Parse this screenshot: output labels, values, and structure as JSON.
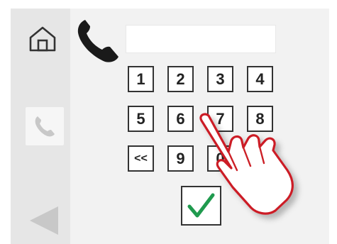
{
  "sidebar": {
    "home": {
      "icon": "home-icon"
    },
    "phone": {
      "icon": "phone-icon"
    },
    "back": {
      "icon": "back-arrow-icon"
    }
  },
  "header": {
    "call_icon": "phone-handset-icon",
    "number_value": ""
  },
  "keypad": {
    "keys": [
      "1",
      "2",
      "3",
      "4",
      "5",
      "6",
      "7",
      "8",
      "<<",
      "9",
      "0"
    ]
  },
  "confirm": {
    "icon": "checkmark-icon"
  },
  "overlay": {
    "icon": "pointing-hand-icon"
  },
  "colors": {
    "frame": "#f2f2f2",
    "sidebar": "#e6e6e6",
    "key_border": "#333333",
    "check": "#1f9a4e",
    "hand_outline": "#cc1f26",
    "side_icon": "#c8c8c8"
  }
}
